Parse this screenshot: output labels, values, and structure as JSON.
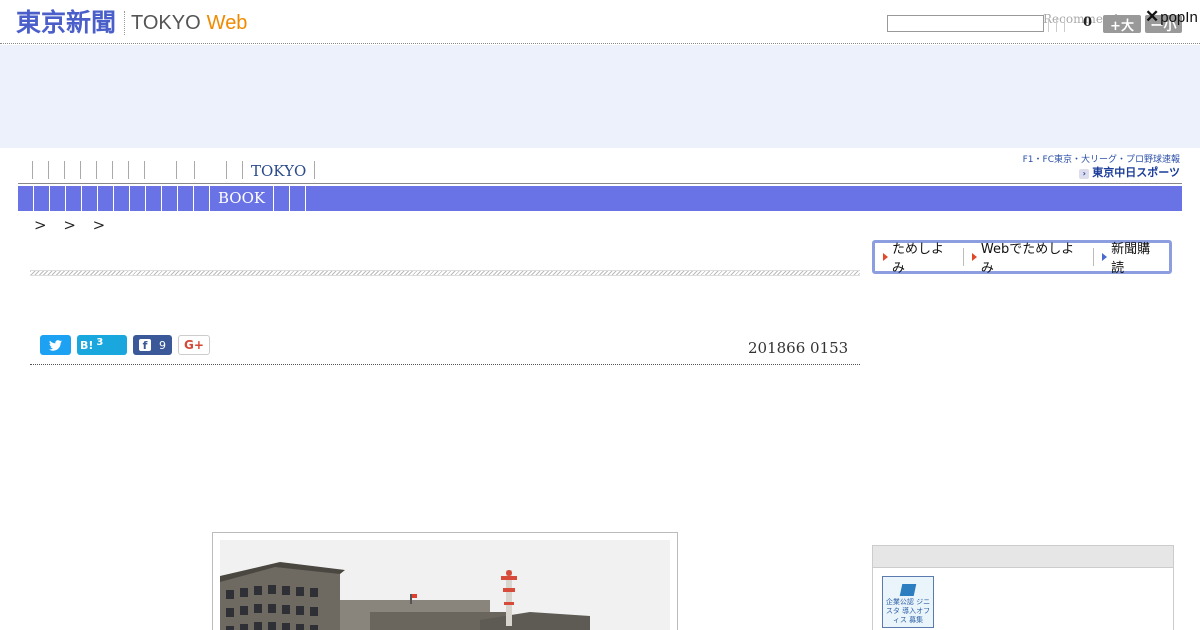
{
  "header": {
    "logo_jp": "東京新聞",
    "logo_tokyo": "TOKYO",
    "logo_web": "Web",
    "search_placeholder": "",
    "recommend_label": "Recommend",
    "count": "0",
    "size_up_label": "+大",
    "size_down_label": "ー小",
    "popin_label": "popIn"
  },
  "subnav": {
    "label": "TOKYO"
  },
  "chunichi": {
    "line1": "F1・FC東京・大リーグ・プロ野球速報",
    "line2": "東京中日スポーツ"
  },
  "mainnav": {
    "label": "BOOK"
  },
  "breadcrumb": {
    "text": "> > >"
  },
  "subscribe": {
    "items": [
      "ためしよみ",
      "Webでためしよみ",
      "新聞購読"
    ]
  },
  "social": {
    "hatena_label": "B!",
    "hatena_count": "3",
    "facebook_count": "9",
    "gplus_label": "G+"
  },
  "article": {
    "date": "201866 0153"
  },
  "sidebar": {
    "badge_text": "企業公認 ジニスタ 導入オフィス 募集"
  },
  "colors": {
    "nav_bg": "#6a73e6",
    "logo_blue": "#4a5fc9",
    "logo_orange": "#f08a00",
    "ad_band": "#ecf1fb"
  }
}
